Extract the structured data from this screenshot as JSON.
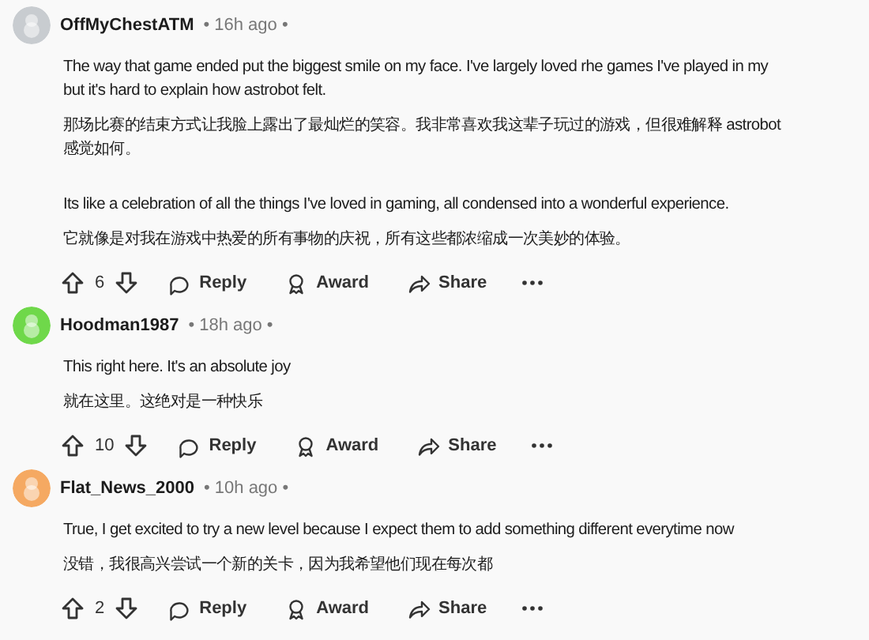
{
  "comments": [
    {
      "author": "OffMyChestATM",
      "time": "• 16h ago •",
      "color": "#c8ccd0",
      "paragraphs": [
        "The way that game ended put the biggest smile on my face. I've largely loved rhe games I've played in my\nbut it's hard to explain how astrobot felt.",
        "那场比赛的结束方式让我脸上露出了最灿烂的笑容。我非常喜欢我这辈子玩过的游戏，但很难解释 astrobot\n感觉如何。",
        "Its like a celebration of all the things I've loved in gaming, all condensed into a wonderful experience.",
        "它就像是对我在游戏中热爱的所有事物的庆祝，所有这些都浓缩成一次美妙的体验。"
      ],
      "votes": "6",
      "actions": [
        "Reply",
        "Award",
        "Share"
      ]
    },
    {
      "author": "Hoodman1987",
      "time": "• 18h ago •",
      "color": "#6fd84a",
      "paragraphs": [
        "This right here. It's an absolute joy",
        "就在这里。这绝对是一种快乐"
      ],
      "votes": "10",
      "actions": [
        "Reply",
        "Award",
        "Share"
      ]
    },
    {
      "author": "Flat_News_2000",
      "time": "• 10h ago •",
      "color": "#f5a962",
      "paragraphs": [
        "True, I get excited to try a new level because I expect them to add something different everytime now",
        "没错，我很高兴尝试一个新的关卡，因为我希望他们现在每次都"
      ],
      "votes": "2",
      "actions": [
        "Reply",
        "Award",
        "Share"
      ]
    }
  ]
}
